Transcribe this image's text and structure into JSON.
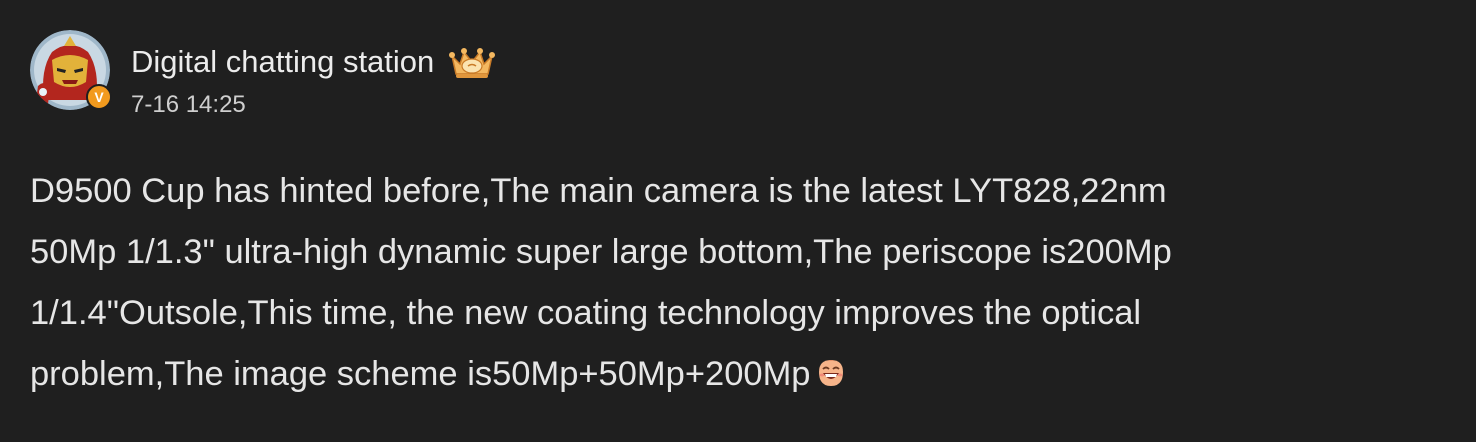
{
  "author": {
    "name": "Digital chatting station",
    "avatar_icon": "iron-man-avatar-icon",
    "verified_badge": "V",
    "rank_icon": "crown-rank-icon"
  },
  "timestamp": "7-16 14:25",
  "content": {
    "lines": [
      "D9500 Cup has hinted before,The main camera is the latest LYT828,22nm",
      "50Mp 1/1.3\" ultra-high dynamic super large bottom,The periscope is200Mp",
      "1/1.4\"Outsole,This time, the new coating technology improves the optical",
      "problem,The image scheme is50Mp+50Mp+200Mp"
    ],
    "trailing_emoji": "grinning-emoji-icon"
  },
  "colors": {
    "background": "#1f1f1f",
    "text": "#e6e6e6",
    "badge": "#f29a1e"
  }
}
